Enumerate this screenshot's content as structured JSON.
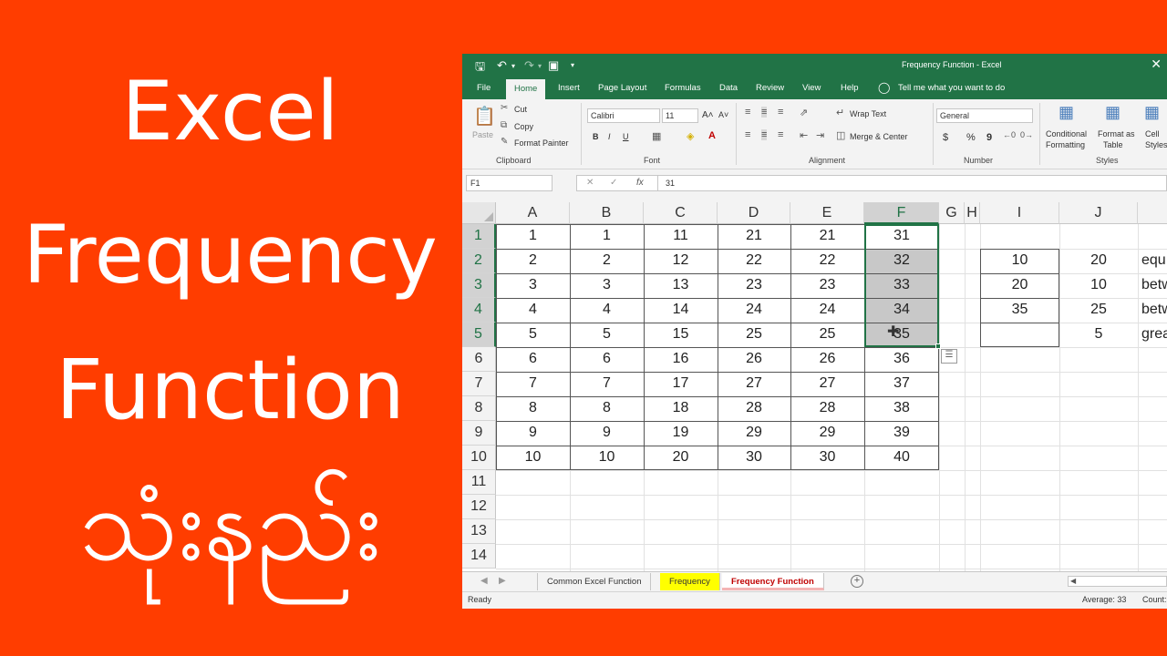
{
  "thumbnail": {
    "line1": "Excel",
    "line2": "Frequency",
    "line3": "Function",
    "line4": "သုံးနည်း",
    "bg_color": "#ff3d00",
    "text_color": "#ffffff"
  },
  "window": {
    "title": "Frequency Function  -  Excel",
    "accent": "#217346"
  },
  "qat": {
    "save_icon": "save-icon",
    "undo_icon": "undo-icon",
    "redo_icon": "redo-icon",
    "camera_icon": "camera-icon",
    "customize_icon": "customize-qat-icon"
  },
  "ribbon_tabs": [
    "File",
    "Home",
    "Insert",
    "Page Layout",
    "Formulas",
    "Data",
    "Review",
    "View",
    "Help"
  ],
  "active_tab": "Home",
  "tell_me": "Tell me what you want to do",
  "clipboard": {
    "paste": "Paste",
    "cut": "Cut",
    "copy": "Copy",
    "format_painter": "Format Painter",
    "group": "Clipboard"
  },
  "font": {
    "name": "Calibri",
    "size": "11",
    "bold": "B",
    "italic": "I",
    "underline": "U",
    "grow": "A˄",
    "shrink": "A˅",
    "group": "Font"
  },
  "alignment": {
    "wrap": "Wrap Text",
    "merge": "Merge & Center",
    "group": "Alignment"
  },
  "number": {
    "format": "General",
    "currency": "$",
    "percent": "%",
    "comma": "9",
    "group": "Number"
  },
  "styles": {
    "conditional": "Conditional",
    "conditional2": "Formatting",
    "format_as": "Format as",
    "format_as2": "Table",
    "cell": "Cell",
    "cell2": "Styles",
    "group": "Styles"
  },
  "formula_bar": {
    "name_box": "F1",
    "cancel": "✕",
    "enter": "✓",
    "fx": "fx",
    "value": "31"
  },
  "columns": [
    "A",
    "B",
    "C",
    "D",
    "E",
    "F",
    "G",
    "H",
    "I",
    "J",
    ""
  ],
  "selected_column": "F",
  "rows": [
    "1",
    "2",
    "3",
    "4",
    "5",
    "6",
    "7",
    "8",
    "9",
    "10",
    "11",
    "12",
    "13",
    "14"
  ],
  "selected_rows": [
    "1",
    "2",
    "3",
    "4",
    "5"
  ],
  "table_data": [
    [
      "1",
      "1",
      "11",
      "21",
      "21",
      "31"
    ],
    [
      "2",
      "2",
      "12",
      "22",
      "22",
      "32"
    ],
    [
      "3",
      "3",
      "13",
      "23",
      "23",
      "33"
    ],
    [
      "4",
      "4",
      "14",
      "24",
      "24",
      "34"
    ],
    [
      "5",
      "5",
      "15",
      "25",
      "25",
      "35"
    ],
    [
      "6",
      "6",
      "16",
      "26",
      "26",
      "36"
    ],
    [
      "7",
      "7",
      "17",
      "27",
      "27",
      "37"
    ],
    [
      "8",
      "8",
      "18",
      "28",
      "28",
      "38"
    ],
    [
      "9",
      "9",
      "19",
      "29",
      "29",
      "39"
    ],
    [
      "10",
      "10",
      "20",
      "30",
      "30",
      "40"
    ]
  ],
  "bins": [
    {
      "i": "10",
      "j": "20",
      "k": "equ"
    },
    {
      "i": "20",
      "j": "10",
      "k": "betw"
    },
    {
      "i": "35",
      "j": "25",
      "k": "betw"
    },
    {
      "i": "",
      "j": "5",
      "k": "grea"
    }
  ],
  "sheet_tabs": [
    "Common Excel Function",
    "Frequency",
    "Frequency Function"
  ],
  "active_sheet": "Frequency Function",
  "status": {
    "ready": "Ready",
    "average": "Average: 33",
    "count": "Count:"
  }
}
